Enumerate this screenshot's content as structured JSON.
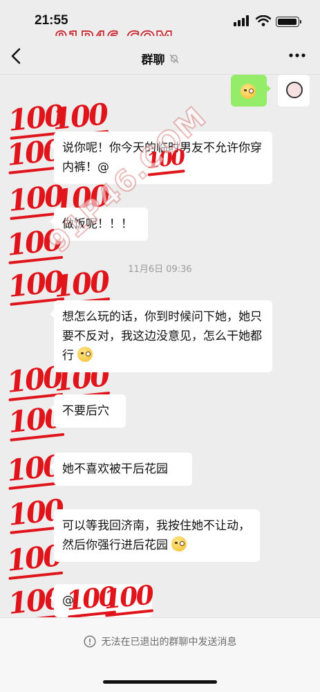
{
  "status_bar": {
    "time": "21:55"
  },
  "watermark": {
    "text": "91P46.COM"
  },
  "nav": {
    "title": "群聊"
  },
  "messages": [
    {
      "text": "说你呢！你今天的临时男友不允许你穿内裤！@"
    },
    {
      "text": "做饭呢！！！"
    },
    {
      "timestamp": "11月6日 09:36"
    },
    {
      "text": "想怎么玩的话，你到时候问下她，她只要不反对，我这边没意见，怎么干她都行"
    },
    {
      "text": "不要后穴"
    },
    {
      "text": "她不喜欢被干后花园"
    },
    {
      "text": "可以等我回济南，我按住她不让动，然后你强行进后花园"
    },
    {
      "text": "@"
    }
  ],
  "footer": {
    "notice": "无法在已退出的群聊中发送消息"
  },
  "icons": {
    "back": "chevron-left-icon",
    "mute": "bell-off-icon",
    "more": "more-dots-icon",
    "notice": "exclamation-circle-icon"
  },
  "colors": {
    "background": "#ededed",
    "my_bubble": "#95ec69",
    "emoji_accent": "#e0141b"
  }
}
